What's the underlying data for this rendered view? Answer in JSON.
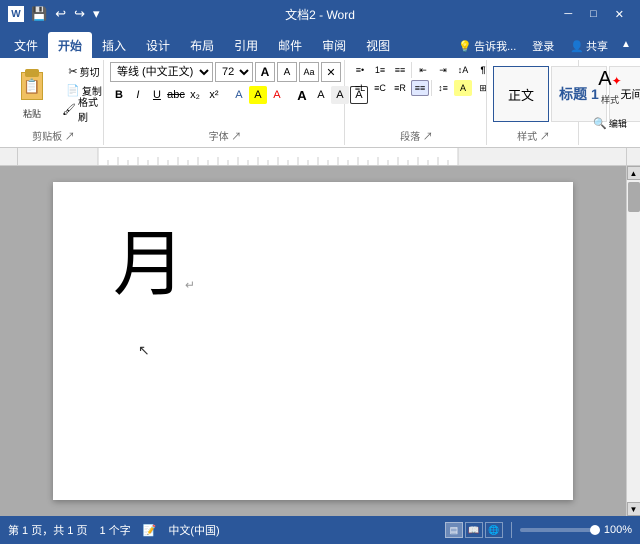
{
  "titlebar": {
    "title": "文档2 - Word",
    "save_label": "💾",
    "undo_label": "↩",
    "redo_label": "↪",
    "customize_label": "▾",
    "minimize": "─",
    "maximize": "□",
    "close": "✕"
  },
  "tabs": {
    "items": [
      "文件",
      "开始",
      "插入",
      "设计",
      "布局",
      "引用",
      "邮件",
      "审阅",
      "视图"
    ],
    "active": "开始",
    "right": [
      "💡 告诉我...",
      "登录",
      "共享"
    ]
  },
  "ribbon": {
    "groups": [
      {
        "name": "剪贴板",
        "label": "剪贴板"
      },
      {
        "name": "字体",
        "label": "字体",
        "font_name": "等线 (中文正文)",
        "font_size": "72"
      },
      {
        "name": "段落",
        "label": "段落"
      },
      {
        "name": "样式",
        "label": "样式",
        "styles": [
          "正文",
          "标题 1",
          "无间隔"
        ]
      },
      {
        "name": "编辑",
        "label": "编辑"
      }
    ]
  },
  "document": {
    "content": "月",
    "page_count": "共 1 页",
    "current_page": "第 1 页",
    "word_count": "1 个字",
    "language": "中文(中国)"
  },
  "statusbar": {
    "page": "第 1 页，共 1 页",
    "words": "1 个字",
    "lang": "中文(中国)",
    "zoom": "100%"
  }
}
